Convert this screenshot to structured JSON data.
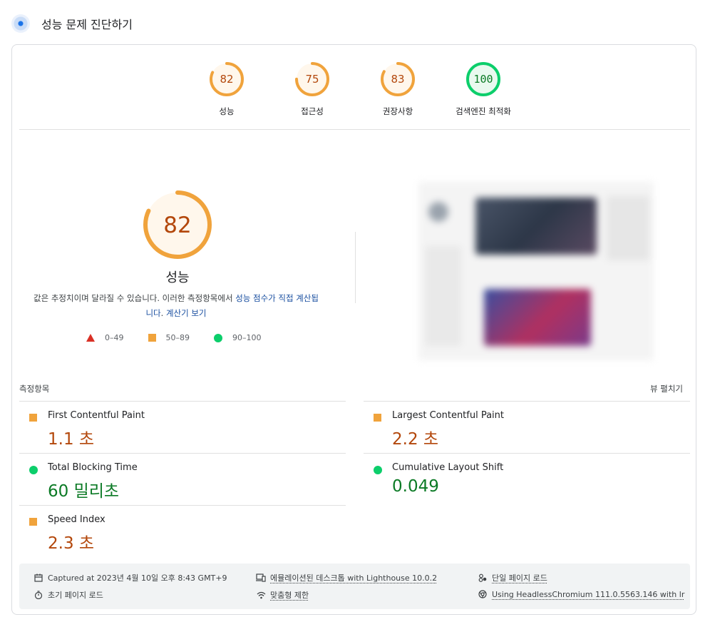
{
  "header": {
    "title": "성능 문제 진단하기"
  },
  "categories": [
    {
      "score": "82",
      "label": "성능",
      "level": 0.82,
      "color": "#f0a33c",
      "fill": "#fff7ec",
      "text_color": "#b3470b"
    },
    {
      "score": "75",
      "label": "접근성",
      "level": 0.75,
      "color": "#f0a33c",
      "fill": "#fff7ec",
      "text_color": "#b3470b"
    },
    {
      "score": "83",
      "label": "권장사항",
      "level": 0.83,
      "color": "#f0a33c",
      "fill": "#fff7ec",
      "text_color": "#b3470b"
    },
    {
      "score": "100",
      "label": "검색엔진 최적화",
      "level": 1.0,
      "color": "#0cce6b",
      "fill": "#e9f9ef",
      "text_color": "#0b7a25"
    }
  ],
  "performance": {
    "score": "82",
    "level": 0.82,
    "title": "성능",
    "desc_part1": "값은 추정치이며 달라질 수 있습니다. 이러한 측정항목에서 ",
    "desc_link1": "성능 점수가 직접 계산됩니다",
    "desc_part2": ". ",
    "desc_link2": "계산기 보기",
    "legend": [
      {
        "range": "0–49",
        "icon": "fail-triangle-icon",
        "color": "#d93025"
      },
      {
        "range": "50–89",
        "icon": "average-square-icon",
        "color": "#f0a33c"
      },
      {
        "range": "90–100",
        "icon": "pass-circle-icon",
        "color": "#0cce6b"
      }
    ]
  },
  "metrics": {
    "section_label": "측정항목",
    "expand_label": "뷰 펼치기",
    "items": [
      {
        "name": "First Contentful Paint",
        "value": "1.1 초",
        "status": "average"
      },
      {
        "name": "Largest Contentful Paint",
        "value": "2.2 초",
        "status": "average"
      },
      {
        "name": "Total Blocking Time",
        "value": "60 밀리초",
        "status": "pass"
      },
      {
        "name": "Cumulative Layout Shift",
        "value": "0.049",
        "status": "pass"
      },
      {
        "name": "Speed Index",
        "value": "2.3 초",
        "status": "average"
      }
    ]
  },
  "footer": {
    "captured": "Captured at 2023년 4월 10일 오후 8:43 GMT+9",
    "initial_load": "초기 페이지 로드",
    "emulated": "에뮬레이션된 데스크톱 with Lighthouse 10.0.2",
    "throttling": "맞춤형 제한",
    "single_load": "단일 페이지 로드",
    "browser": "Using HeadlessChromium 111.0.5563.146 with lr"
  }
}
